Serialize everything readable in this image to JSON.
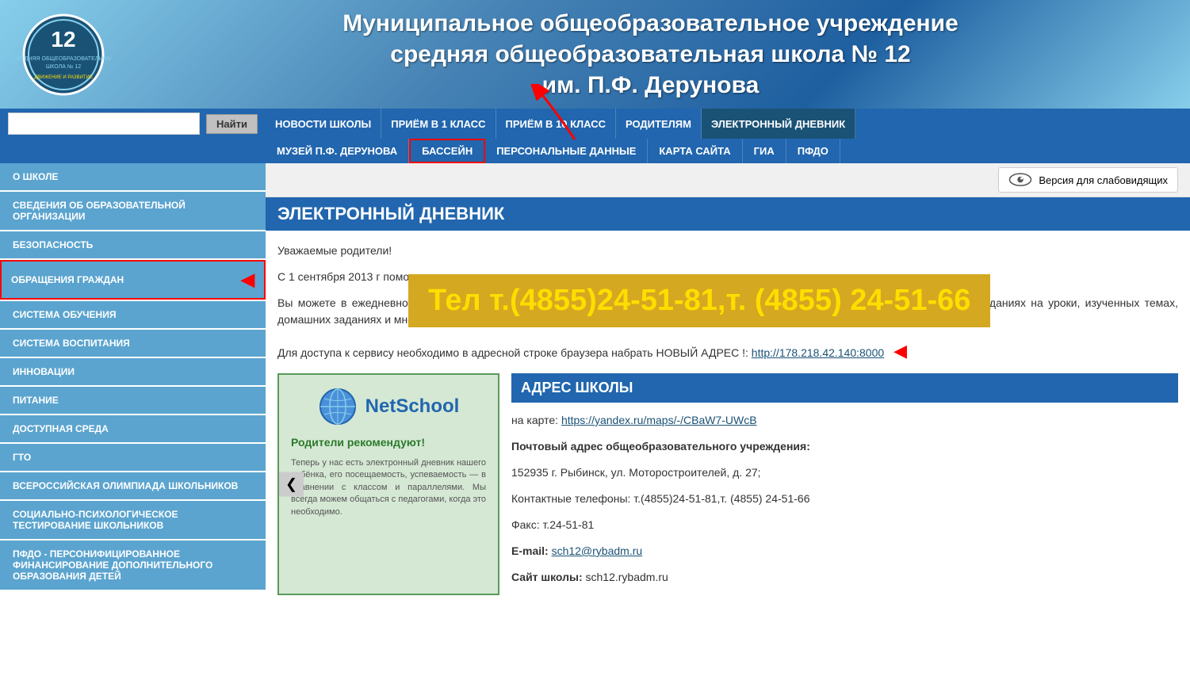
{
  "header": {
    "title_line1": "Муниципальное общеобразовательное  учреждение",
    "title_line2": "средняя общеобразовательная школа № 12",
    "title_line3": "им. П.Ф. Дерунова",
    "school_number": "12"
  },
  "navbar": {
    "search_placeholder": "",
    "search_btn": "Найти",
    "row1": [
      {
        "label": "НОВОСТИ ШКОЛЫ",
        "active": false
      },
      {
        "label": "ПРИЁМ В 1 КЛАСС",
        "active": false
      },
      {
        "label": "ПРИЁМ В 10 КЛАСС",
        "active": false
      },
      {
        "label": "РОДИТЕЛЯМ",
        "active": false
      },
      {
        "label": "ЭЛЕКТРОННЫЙ ДНЕВНИК",
        "active": true
      }
    ],
    "row2": [
      {
        "label": "МУЗЕЙ П.Ф. ДЕРУНОВА",
        "boxed": false
      },
      {
        "label": "БАССЕЙН",
        "boxed": true
      },
      {
        "label": "ПЕРСОНАЛЬНЫЕ ДАННЫЕ",
        "boxed": false
      },
      {
        "label": "КАРТА САЙТА",
        "boxed": false
      },
      {
        "label": "ГИА",
        "boxed": false
      },
      {
        "label": "ПФДО",
        "boxed": false
      }
    ]
  },
  "accessibility": {
    "label": "Версия для слабовидящих"
  },
  "sidebar": {
    "items": [
      {
        "label": "О ШКОЛЕ",
        "boxed": false
      },
      {
        "label": "СВЕДЕНИЯ ОБ ОБРАЗОВАТЕЛЬНОЙ ОРГАНИЗАЦИИ",
        "boxed": false
      },
      {
        "label": "БЕЗОПАСНОСТЬ",
        "boxed": false
      },
      {
        "label": "ОБРАЩЕНИЯ ГРАЖДАН",
        "boxed": true
      },
      {
        "label": "СИСТЕМА ОБУЧЕНИЯ",
        "boxed": false
      },
      {
        "label": "СИСТЕМА ВОСПИТАНИЯ",
        "boxed": false
      },
      {
        "label": "ИННОВАЦИИ",
        "boxed": false
      },
      {
        "label": "ПИТАНИЕ",
        "boxed": false
      },
      {
        "label": "ДОСТУПНАЯ СРЕДА",
        "boxed": false
      },
      {
        "label": "ГТО",
        "boxed": false
      },
      {
        "label": "ВСЕРОССИЙСКАЯ ОЛИМПИАДА ШКОЛЬНИКОВ",
        "boxed": false
      },
      {
        "label": "СОЦИАЛЬНО-ПСИХОЛОГИЧЕСКОЕ ТЕСТИРОВАНИЕ ШКОЛЬНИКОВ",
        "boxed": false
      },
      {
        "label": "ПФДО - ПЕРСОНИФИЦИРОВАННОЕ ФИНАНСИРОВАНИЕ ДОПОЛНИТЕЛЬНОГО ОБРАЗОВАНИЯ ДЕТЕЙ",
        "boxed": false
      }
    ]
  },
  "content": {
    "section_title": "ЭЛЕКТРОННЫЙ ДНЕВНИК",
    "para1": "Уважаемые родители!",
    "para2_prefix": "С 1 сентября 2013 г",
    "para2_suffix": "помощью программы",
    "para3": "Вы можете в ежедневном режиме узнавать оценки своих детей по всем преподаваемым в школе предметам, информацию об опозданиях на уроки, изученных темах, домашних заданиях и многое другое.",
    "para4_prefix": "Для доступа к сервису необходимо в адресной строке браузера набрать НОВЫЙ АДРЕС !: ",
    "address_link": "http://178.218.42.140:8000",
    "phone_overlay": "Тел т.(4855)24-51-81,т. (4855) 24-51-66"
  },
  "address_box": {
    "header": "АДРЕС ШКОЛЫ",
    "map_prefix": "на карте: ",
    "map_link": "https://yandex.ru/maps/-/CBaW7-UWcB",
    "map_link_text": "https://yandex.ru/maps/-/CBaW7-UWcB",
    "postal": "Почтовый адрес общеобразовательного учреждения:",
    "address": "152935 г. Рыбинск, ул. Моторостроителей, д. 27;",
    "phones": "Контактные телефоны:  т.(4855)24-51-81,т. (4855) 24-51-66",
    "fax": "Факс: т.24-51-81",
    "email_prefix": "E-mail: ",
    "email": "sch12@rybadm.ru",
    "site_prefix": "Сайт школы: ",
    "site": "sch12.rybadm.ru"
  },
  "netschool": {
    "logo": "NetSchool",
    "recommendation": "Родители рекомендуют!"
  }
}
